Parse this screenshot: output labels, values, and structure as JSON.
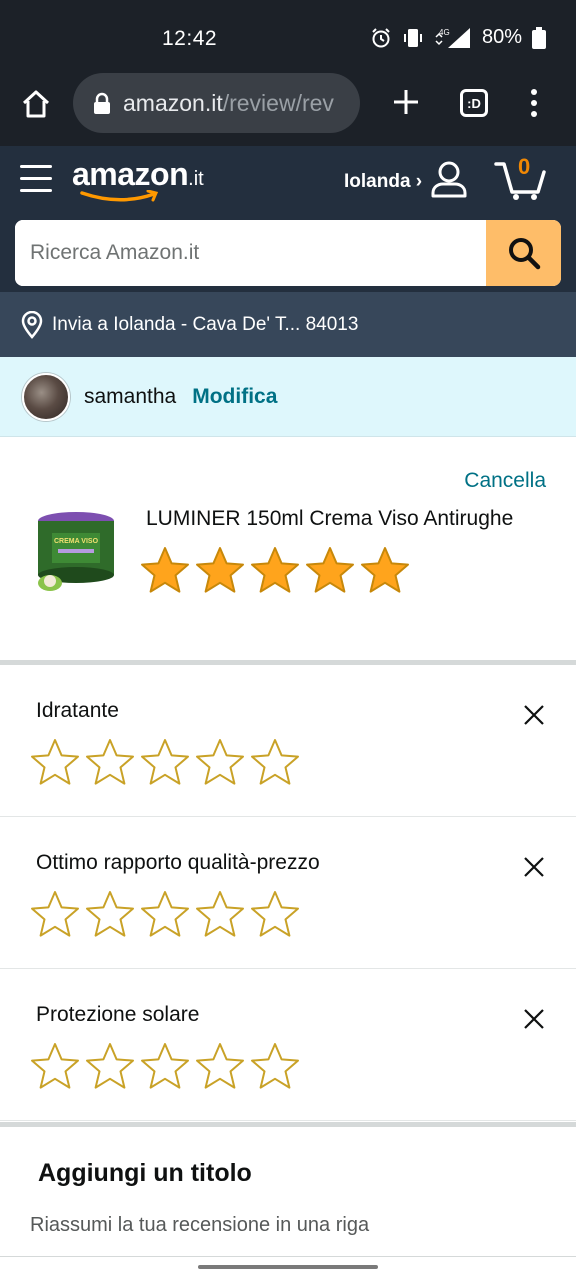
{
  "status_bar": {
    "time": "12:42",
    "battery": "80%",
    "network": "4G"
  },
  "browser": {
    "url_host": "amazon.it",
    "url_path": "/review/rev",
    "tab_count": ":D",
    "icons": [
      "home-icon",
      "lock-icon",
      "plus-icon",
      "tabs-icon",
      "more-vert-icon"
    ]
  },
  "header": {
    "logo_word": "amazon",
    "logo_tld": ".it",
    "account_label": "Iolanda ›",
    "cart_count": "0",
    "search_placeholder": "Ricerca Amazon.it"
  },
  "delivery": {
    "text": "Invia a Iolanda - Cava De' T... 84013"
  },
  "profile": {
    "name": "samantha",
    "edit_label": "Modifica"
  },
  "product": {
    "cancel_label": "Cancella",
    "title": "LUMINER 150ml Crema Viso Antirughe",
    "image_caption": "CREMA VISO",
    "rating": 5,
    "max_rating": 5
  },
  "attributes": [
    {
      "label": "Idratante",
      "rating": 0
    },
    {
      "label": "Ottimo rapporto qualità-prezzo",
      "rating": 0
    },
    {
      "label": "Protezione solare",
      "rating": 0
    }
  ],
  "review_title": {
    "heading": "Aggiungi un titolo",
    "placeholder": "Riassumi la tua recensione in una riga"
  },
  "colors": {
    "accent_link": "#007185",
    "star_fill": "#ffa41c",
    "search_button": "#febd69",
    "header_bg": "#232f3e"
  }
}
